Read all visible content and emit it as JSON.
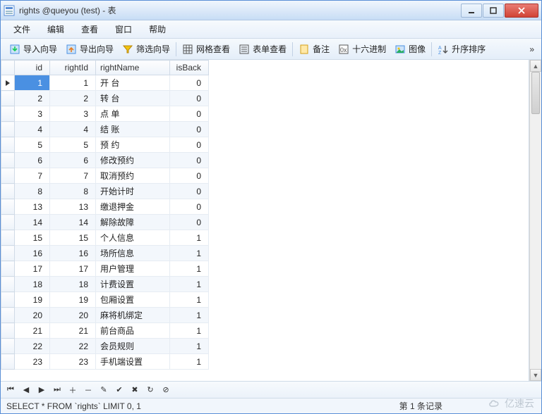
{
  "window": {
    "title": "rights @queyou (test) - 表"
  },
  "menu": {
    "file": "文件",
    "edit": "编辑",
    "view": "查看",
    "window": "窗口",
    "help": "帮助"
  },
  "toolbar": {
    "import": "导入向导",
    "export": "导出向导",
    "filter": "筛选向导",
    "grid": "网格查看",
    "form": "表单查看",
    "memo": "备注",
    "hex": "十六进制",
    "image": "图像",
    "sort": "升序排序",
    "overflow": "»"
  },
  "columns": {
    "id": "id",
    "rightId": "rightId",
    "rightName": "rightName",
    "isBack": "isBack"
  },
  "rows": [
    {
      "id": "1",
      "rightId": "1",
      "rightName": "开 台",
      "isBack": "0",
      "current": true,
      "selected": true
    },
    {
      "id": "2",
      "rightId": "2",
      "rightName": "转 台",
      "isBack": "0"
    },
    {
      "id": "3",
      "rightId": "3",
      "rightName": "点 单",
      "isBack": "0"
    },
    {
      "id": "4",
      "rightId": "4",
      "rightName": "结 账",
      "isBack": "0"
    },
    {
      "id": "5",
      "rightId": "5",
      "rightName": "预 约",
      "isBack": "0"
    },
    {
      "id": "6",
      "rightId": "6",
      "rightName": "修改预约",
      "isBack": "0"
    },
    {
      "id": "7",
      "rightId": "7",
      "rightName": "取消预约",
      "isBack": "0"
    },
    {
      "id": "8",
      "rightId": "8",
      "rightName": "开始计时",
      "isBack": "0"
    },
    {
      "id": "13",
      "rightId": "13",
      "rightName": "缴退押金",
      "isBack": "0"
    },
    {
      "id": "14",
      "rightId": "14",
      "rightName": "解除故障",
      "isBack": "0"
    },
    {
      "id": "15",
      "rightId": "15",
      "rightName": "个人信息",
      "isBack": "1"
    },
    {
      "id": "16",
      "rightId": "16",
      "rightName": "场所信息",
      "isBack": "1"
    },
    {
      "id": "17",
      "rightId": "17",
      "rightName": "用户管理",
      "isBack": "1"
    },
    {
      "id": "18",
      "rightId": "18",
      "rightName": "计费设置",
      "isBack": "1"
    },
    {
      "id": "19",
      "rightId": "19",
      "rightName": "包厢设置",
      "isBack": "1"
    },
    {
      "id": "20",
      "rightId": "20",
      "rightName": "麻将机绑定",
      "isBack": "1"
    },
    {
      "id": "21",
      "rightId": "21",
      "rightName": "前台商品",
      "isBack": "1"
    },
    {
      "id": "22",
      "rightId": "22",
      "rightName": "会员规则",
      "isBack": "1"
    },
    {
      "id": "23",
      "rightId": "23",
      "rightName": "手机端设置",
      "isBack": "1"
    }
  ],
  "status": {
    "sql": "SELECT * FROM `rights` LIMIT 0, 1",
    "position": "第 1 条记录"
  },
  "watermark": "亿速云"
}
